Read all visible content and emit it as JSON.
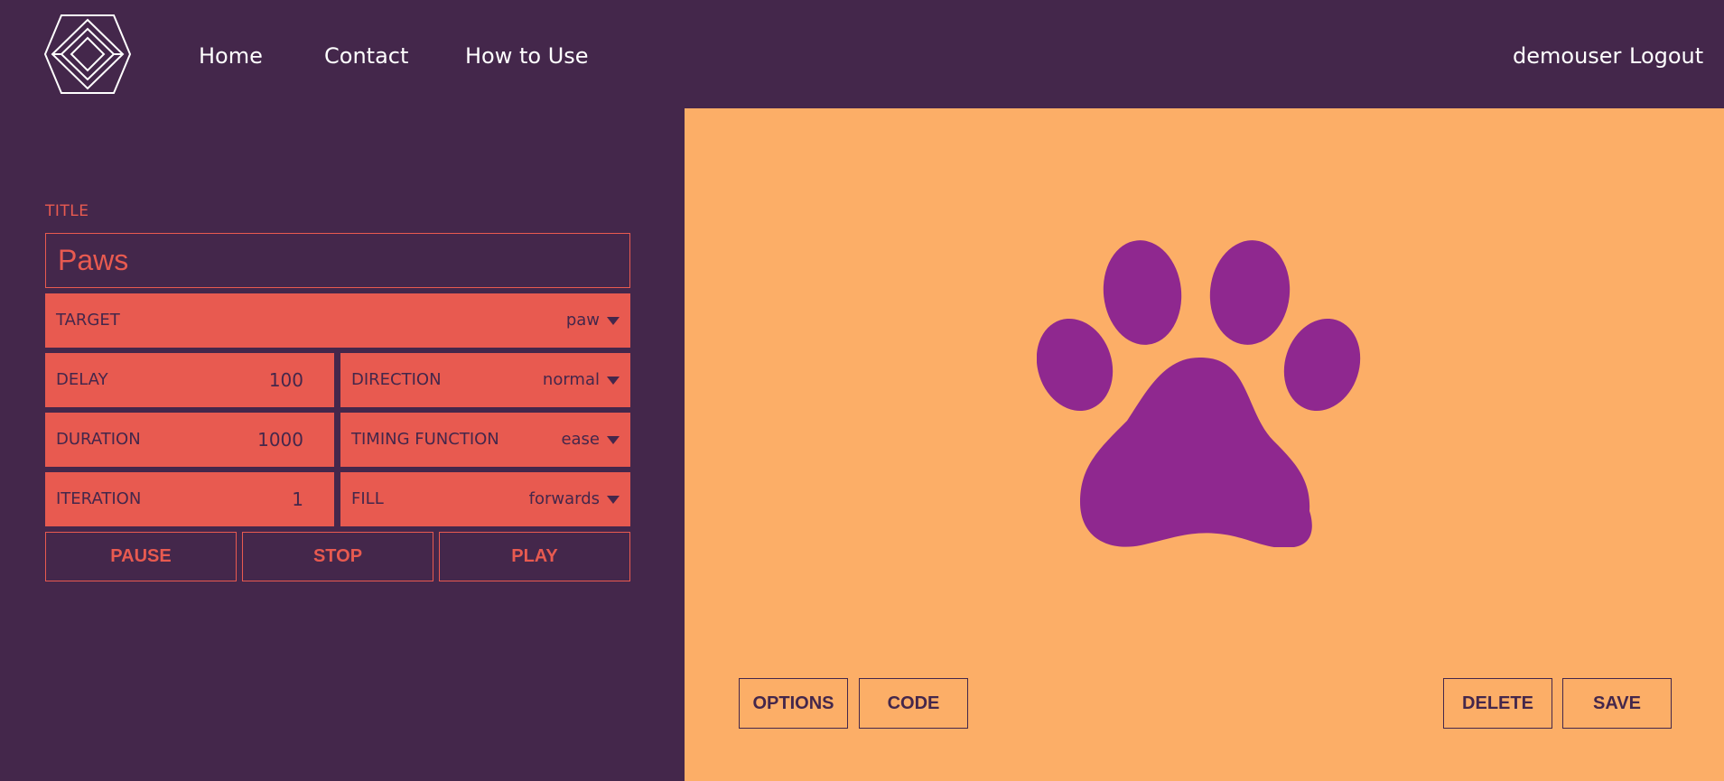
{
  "nav": {
    "home": "Home",
    "contact": "Contact",
    "how_to_use": "How to Use",
    "username": "demouser",
    "logout": "Logout"
  },
  "editor": {
    "title_label": "TITLE",
    "title_value": "Paws",
    "target": {
      "label": "TARGET",
      "value": "paw"
    },
    "delay": {
      "label": "DELAY",
      "value": "100"
    },
    "direction": {
      "label": "DIRECTION",
      "value": "normal"
    },
    "duration": {
      "label": "DURATION",
      "value": "1000"
    },
    "timing_function": {
      "label": "TIMING FUNCTION",
      "value": "ease"
    },
    "iteration": {
      "label": "ITERATION",
      "value": "1"
    },
    "fill": {
      "label": "FILL",
      "value": "forwards"
    },
    "buttons": {
      "pause": "PAUSE",
      "stop": "STOP",
      "play": "PLAY"
    }
  },
  "stage": {
    "buttons": {
      "options": "OPTIONS",
      "code": "CODE",
      "delete": "DELETE",
      "save": "SAVE"
    }
  },
  "colors": {
    "background": "#44274b",
    "accent": "#e85a50",
    "stage": "#fcae67",
    "paw": "#8f288f"
  },
  "icons": {
    "logo": "diamond-logo-icon",
    "caret": "caret-down-icon",
    "paw": "paw-icon"
  }
}
